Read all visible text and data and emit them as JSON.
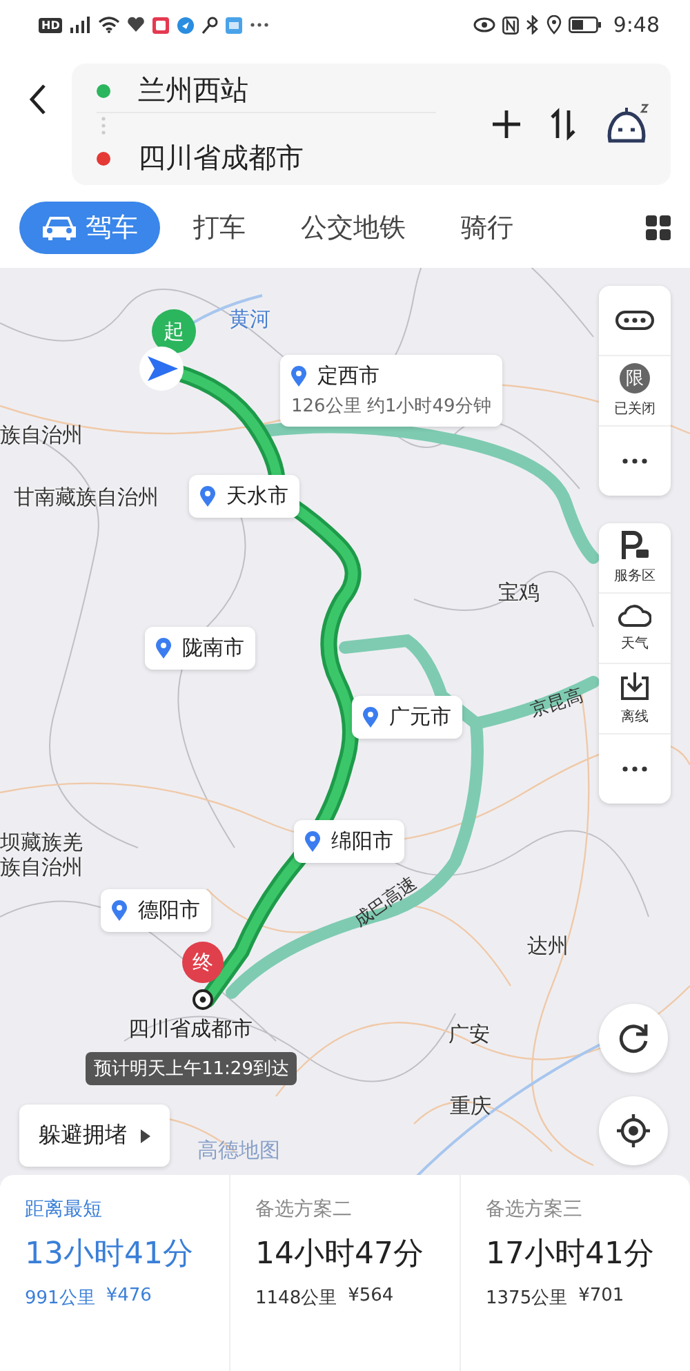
{
  "status_bar": {
    "badge": "HD",
    "time": "9:48"
  },
  "route_header": {
    "origin": "兰州西站",
    "destination": "四川省成都市"
  },
  "tabs": [
    {
      "label": "驾车",
      "selected": true
    },
    {
      "label": "打车",
      "selected": false
    },
    {
      "label": "公交地铁",
      "selected": false
    },
    {
      "label": "骑行",
      "selected": false
    }
  ],
  "map": {
    "start_marker": "起",
    "end_marker": "终",
    "place_labels": [
      "黄河",
      "族自治州",
      "甘南藏族自治州",
      "宝鸡",
      "坝藏族羌",
      "族自治州",
      "达州",
      "广安",
      "重庆"
    ],
    "road_labels": [
      "成巴高速",
      "京昆高"
    ],
    "callouts": [
      {
        "city": "定西市",
        "detail": "126公里 约1小时49分钟"
      },
      {
        "city": "天水市"
      },
      {
        "city": "陇南市"
      },
      {
        "city": "广元市"
      },
      {
        "city": "绵阳市"
      },
      {
        "city": "德阳市"
      }
    ],
    "destination_label": "四川省成都市",
    "eta": "预计明天上午11:29到达",
    "avoid_congestion": "躲避拥堵",
    "map_logo": "高德地图",
    "toolbar_top": [
      {
        "kind": "traffic"
      },
      {
        "kind": "badge",
        "badge": "限",
        "label": "已关闭"
      },
      {
        "kind": "more"
      }
    ],
    "toolbar_bottom": [
      {
        "kind": "parking",
        "label": "服务区"
      },
      {
        "kind": "weather",
        "label": "天气"
      },
      {
        "kind": "offline",
        "label": "离线"
      },
      {
        "kind": "more"
      }
    ]
  },
  "routes": [
    {
      "tag": "距离最短",
      "duration": "13小时41分",
      "distance": "991公里",
      "cost": "¥476",
      "selected": true
    },
    {
      "tag": "备选方案二",
      "duration": "14小时47分",
      "distance": "1148公里",
      "cost": "¥564",
      "selected": false
    },
    {
      "tag": "备选方案三",
      "duration": "17小时41分",
      "distance": "1375公里",
      "cost": "¥701",
      "selected": false
    }
  ]
}
